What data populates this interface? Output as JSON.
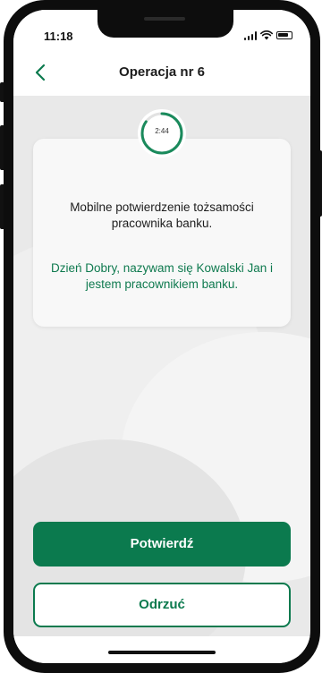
{
  "status_bar": {
    "time": "11:18",
    "icons": [
      "signal-icon",
      "wifi-icon",
      "battery-icon"
    ]
  },
  "header": {
    "back_icon": "chevron-left-icon",
    "title": "Operacja nr 6"
  },
  "timer": {
    "label": "2:44",
    "remaining_fraction": 0.85
  },
  "card": {
    "title": "Mobilne potwierdzenie tożsamości pracownika banku.",
    "message": "Dzień Dobry, nazywam się Kowalski Jan i jestem pracownikiem banku."
  },
  "actions": {
    "confirm_label": "Potwierdź",
    "reject_label": "Odrzuć"
  },
  "colors": {
    "accent": "#0b7a4e",
    "message_text": "#0f7a4f",
    "background": "#e9e9e9"
  }
}
